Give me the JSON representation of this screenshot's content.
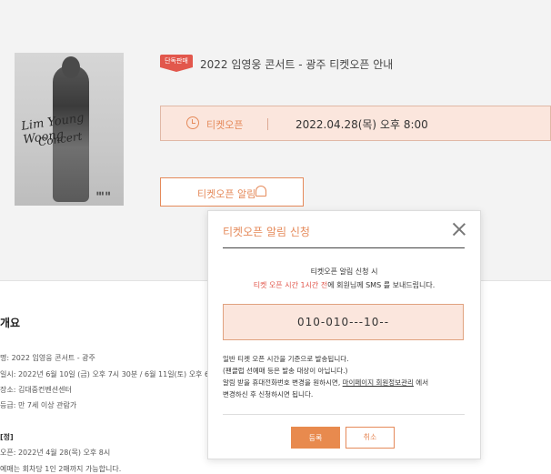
{
  "poster": {
    "script_line1": "Lim Young Woong",
    "script_line2": "Concert",
    "logo_text": "▮▮▮ ▮▮"
  },
  "product": {
    "badge": "단독판매",
    "title": "2022 임영웅 콘서트 - 광주 티켓오픈 안내",
    "open_label": "티켓오픈",
    "open_date": "2022.04.28(목) 오후 8:00",
    "alarm_button": "티켓오픈 알림"
  },
  "overview": {
    "heading": "개요",
    "lines": [
      "명: 2022 임영웅 콘서트 - 광주",
      "일시: 2022년 6월 10일 (금) 오후 7시 30분 / 6월 11일(토) 오후 6",
      "장소: 김대중컨벤션센터",
      "등급: 만 7세 이상 관람가",
      "[정]",
      "오픈: 2022년 4월 28(목) 오후 8시",
      "예매는 회차당 1인 2매까지 가능합니다."
    ]
  },
  "modal": {
    "title": "티켓오픈 알림 신청",
    "intro_line1": "티켓오픈 알림 신청 시",
    "intro_red": "티켓 오픈 시간 1시간 전",
    "intro_rest": "에 회원님께 SMS 를 보내드립니다.",
    "phone": "010-010---10--",
    "note1": "일반 티켓 오픈 시간을 기준으로 발송됩니다.",
    "note2": "(팬클럽 선예매 등은 발송 대상이 아닙니다.)",
    "note3_pre": "알림 받을 휴대전화번호 변경을 원하시면, ",
    "note3_link": "마이페이지 회원정보관리",
    "note3_post": " 에서",
    "note4": "변경하신 후 신청하시면 됩니다.",
    "ok": "등록",
    "cancel": "취소"
  },
  "colors": {
    "accent": "#e58a5a",
    "badge": "#e2574c",
    "highlight_bg": "#fbe6dd"
  }
}
